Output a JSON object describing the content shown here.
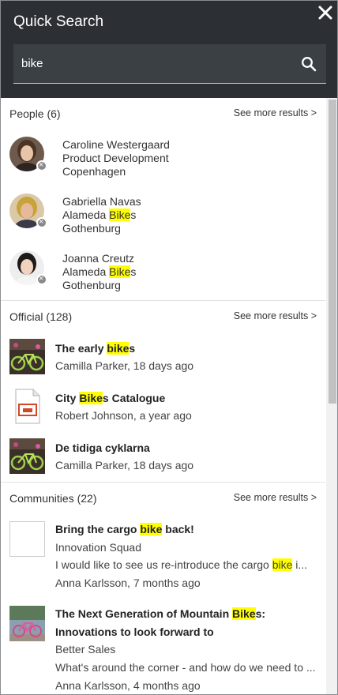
{
  "header": {
    "title": "Quick Search",
    "search_value": "bike"
  },
  "people": {
    "title": "People (6)",
    "see_more": "See more results >",
    "items": [
      {
        "name": "Caroline Westergaard",
        "dept_pre": "Product Development",
        "dept_hl": "",
        "dept_post": "",
        "city": "Copenhagen"
      },
      {
        "name": "Gabriella Navas",
        "dept_pre": "Alameda ",
        "dept_hl": "Bike",
        "dept_post": "s",
        "city": "Gothenburg"
      },
      {
        "name": "Joanna Creutz",
        "dept_pre": "Alameda ",
        "dept_hl": "Bike",
        "dept_post": "s",
        "city": "Gothenburg"
      }
    ]
  },
  "official": {
    "title": "Official (128)",
    "see_more": "See more results >",
    "items": [
      {
        "t_pre": "The early ",
        "t_hl": "bike",
        "t_post": "s",
        "meta": "Camilla Parker, 18 days ago"
      },
      {
        "t_pre": "City ",
        "t_hl": "Bike",
        "t_post": "s Catalogue",
        "meta": "Robert Johnson, a year ago"
      },
      {
        "t_pre": "De tidiga cyklarna",
        "t_hl": "",
        "t_post": "",
        "meta": "Camilla Parker, 18 days ago"
      }
    ]
  },
  "communities": {
    "title": "Communities (22)",
    "see_more": "See more results >",
    "items": [
      {
        "t_pre": "Bring the cargo ",
        "t_hl": "bike",
        "t_post": " back!",
        "t2": "",
        "group": "Innovation Squad",
        "ex_pre": "I would like to see us re-introduce the cargo ",
        "ex_hl": "bike",
        "ex_post": " i...",
        "meta": "Anna Karlsson, 7 months ago"
      },
      {
        "t_pre": "The Next Generation of Mountain ",
        "t_hl": "Bike",
        "t_post": "s:",
        "t2": "Innovations to look forward to",
        "group": "Better Sales",
        "ex_pre": "What's around the corner - and how do we need to ...",
        "ex_hl": "",
        "ex_post": "",
        "meta": "Anna Karlsson, 4 months ago"
      }
    ]
  }
}
